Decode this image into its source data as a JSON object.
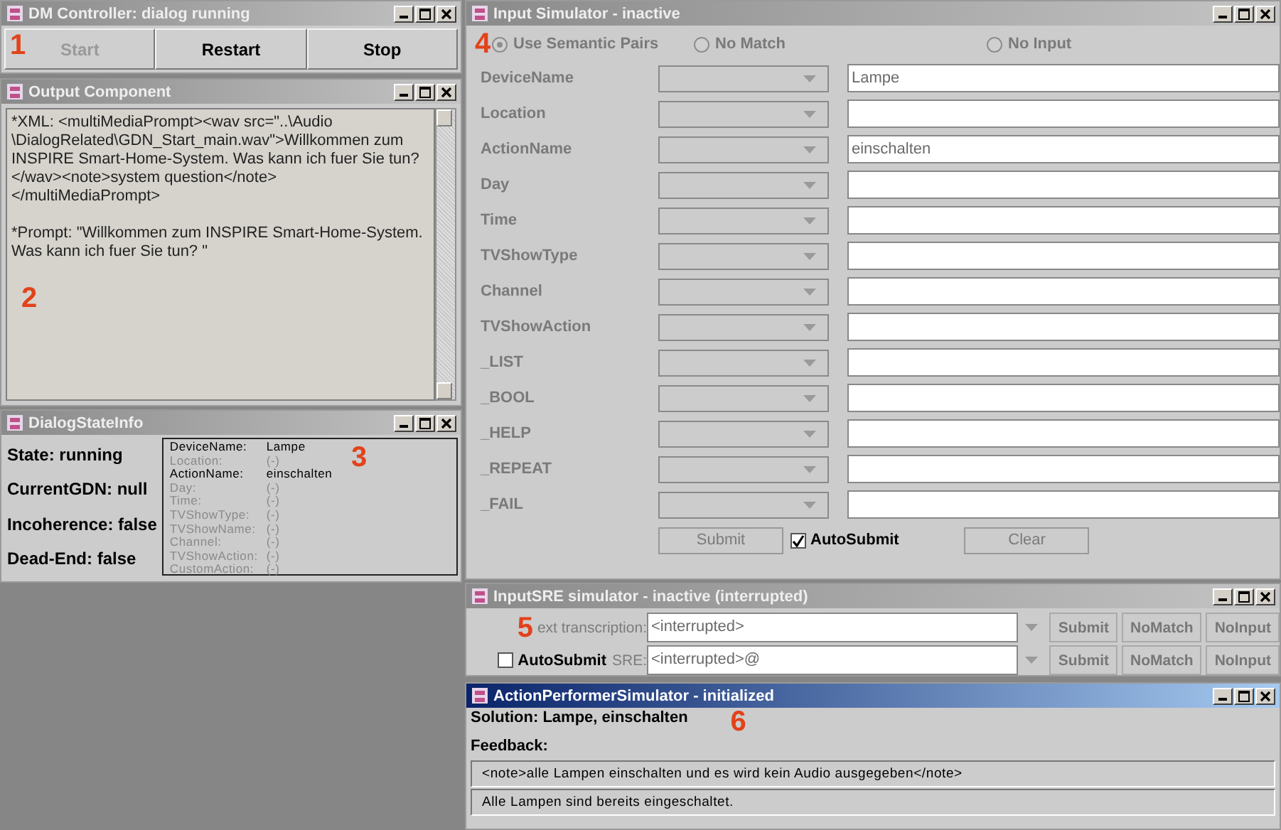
{
  "windows": [
    {
      "kind": "dm_controller",
      "title": "DM Controller: dialog running",
      "focused": false,
      "marker": "1",
      "buttons": [
        {
          "label": "Start",
          "disabled": true
        },
        {
          "label": "Restart",
          "disabled": false
        },
        {
          "label": "Stop",
          "disabled": false
        }
      ]
    },
    {
      "kind": "output",
      "title": "Output Component",
      "focused": false,
      "marker": "2",
      "paragraphs": [
        "*XML: <multiMediaPrompt><wav src=\"..\\Audio \\DialogRelated\\GDN_Start_main.wav\">Willkommen zum INSPIRE Smart-Home-System. Was kann ich fuer Sie tun? </wav><note>system question</note> </multiMediaPrompt>",
        "*Prompt: \"Willkommen zum INSPIRE Smart-Home-System. Was kann ich fuer Sie tun? \""
      ]
    },
    {
      "kind": "dialog_state",
      "title": "DialogStateInfo",
      "focused": false,
      "marker": "3",
      "status": [
        "State: running",
        "CurrentGDN: null",
        "Incoherence: false",
        "Dead-End: false"
      ],
      "slots": [
        {
          "name": "DeviceName:",
          "value": "Lampe",
          "disabled": false
        },
        {
          "name": "Location:",
          "value": "(-)",
          "disabled": true
        },
        {
          "name": "ActionName:",
          "value": "einschalten",
          "disabled": false
        },
        {
          "name": "Day:",
          "value": "(-)",
          "disabled": true
        },
        {
          "name": "Time:",
          "value": "(-)",
          "disabled": true
        },
        {
          "name": "TVShowType:",
          "value": "(-)",
          "disabled": true
        },
        {
          "name": "TVShowName:",
          "value": "(-)",
          "disabled": true
        },
        {
          "name": "Channel:",
          "value": "(-)",
          "disabled": true
        },
        {
          "name": "TVShowAction:",
          "value": "(-)",
          "disabled": true
        },
        {
          "name": "CustomAction:",
          "value": "(-)",
          "disabled": true
        }
      ]
    },
    {
      "kind": "input_simulator",
      "title": "Input Simulator - inactive",
      "focused": false,
      "marker": "4",
      "modes": [
        {
          "label": "Use Semantic Pairs",
          "selected": true
        },
        {
          "label": "No Match",
          "selected": false
        },
        {
          "label": "No Input",
          "selected": false
        }
      ],
      "slots": [
        {
          "name": "DeviceName",
          "value": "Lampe"
        },
        {
          "name": "Location"
        },
        {
          "name": "ActionName",
          "value": "einschalten"
        },
        {
          "name": "Day"
        },
        {
          "name": "Time"
        },
        {
          "name": "TVShowType"
        },
        {
          "name": "Channel"
        },
        {
          "name": "TVShowAction"
        },
        {
          "name": "_LIST"
        },
        {
          "name": "_BOOL"
        },
        {
          "name": "_HELP"
        },
        {
          "name": "_REPEAT"
        },
        {
          "name": "_FAIL"
        }
      ],
      "submit": "Submit",
      "auto_submit": {
        "label": "AutoSubmit",
        "checked": true
      },
      "clear": "Clear"
    },
    {
      "kind": "input_sre",
      "title": "InputSRE simulator - inactive (interrupted)",
      "focused": false,
      "marker": "5",
      "rows": [
        {
          "label": "ext transcription:",
          "value": "<interrupted>",
          "buttons": [
            "Submit",
            "NoMatch",
            "NoInput"
          ]
        },
        {
          "checkbox": {
            "label": "AutoSubmit",
            "checked": false
          },
          "label": "SRE:",
          "value": "<interrupted>@",
          "buttons": [
            "Submit",
            "NoMatch",
            "NoInput"
          ]
        }
      ]
    },
    {
      "kind": "action_performer",
      "title": "ActionPerformerSimulator - initialized",
      "focused": true,
      "marker": "6",
      "solution": "Solution: Lampe, einschalten",
      "feedback_label": "Feedback:",
      "feedback": [
        "<note>alle Lampen einschalten und es wird kein Audio ausgegeben</note>",
        "Alle Lampen sind bereits eingeschaltet."
      ]
    }
  ]
}
